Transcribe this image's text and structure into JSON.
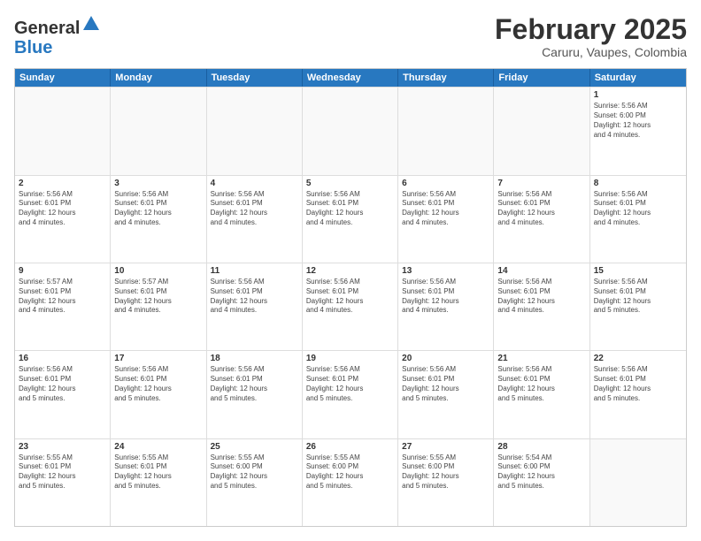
{
  "header": {
    "logo_general": "General",
    "logo_blue": "Blue",
    "month_title": "February 2025",
    "location": "Caruru, Vaupes, Colombia"
  },
  "weekdays": [
    "Sunday",
    "Monday",
    "Tuesday",
    "Wednesday",
    "Thursday",
    "Friday",
    "Saturday"
  ],
  "rows": [
    [
      {
        "day": "",
        "empty": true
      },
      {
        "day": "",
        "empty": true
      },
      {
        "day": "",
        "empty": true
      },
      {
        "day": "",
        "empty": true
      },
      {
        "day": "",
        "empty": true
      },
      {
        "day": "",
        "empty": true
      },
      {
        "day": "1",
        "info": "Sunrise: 5:56 AM\nSunset: 6:00 PM\nDaylight: 12 hours\nand 4 minutes."
      }
    ],
    [
      {
        "day": "2",
        "info": "Sunrise: 5:56 AM\nSunset: 6:01 PM\nDaylight: 12 hours\nand 4 minutes."
      },
      {
        "day": "3",
        "info": "Sunrise: 5:56 AM\nSunset: 6:01 PM\nDaylight: 12 hours\nand 4 minutes."
      },
      {
        "day": "4",
        "info": "Sunrise: 5:56 AM\nSunset: 6:01 PM\nDaylight: 12 hours\nand 4 minutes."
      },
      {
        "day": "5",
        "info": "Sunrise: 5:56 AM\nSunset: 6:01 PM\nDaylight: 12 hours\nand 4 minutes."
      },
      {
        "day": "6",
        "info": "Sunrise: 5:56 AM\nSunset: 6:01 PM\nDaylight: 12 hours\nand 4 minutes."
      },
      {
        "day": "7",
        "info": "Sunrise: 5:56 AM\nSunset: 6:01 PM\nDaylight: 12 hours\nand 4 minutes."
      },
      {
        "day": "8",
        "info": "Sunrise: 5:56 AM\nSunset: 6:01 PM\nDaylight: 12 hours\nand 4 minutes."
      }
    ],
    [
      {
        "day": "9",
        "info": "Sunrise: 5:57 AM\nSunset: 6:01 PM\nDaylight: 12 hours\nand 4 minutes."
      },
      {
        "day": "10",
        "info": "Sunrise: 5:57 AM\nSunset: 6:01 PM\nDaylight: 12 hours\nand 4 minutes."
      },
      {
        "day": "11",
        "info": "Sunrise: 5:56 AM\nSunset: 6:01 PM\nDaylight: 12 hours\nand 4 minutes."
      },
      {
        "day": "12",
        "info": "Sunrise: 5:56 AM\nSunset: 6:01 PM\nDaylight: 12 hours\nand 4 minutes."
      },
      {
        "day": "13",
        "info": "Sunrise: 5:56 AM\nSunset: 6:01 PM\nDaylight: 12 hours\nand 4 minutes."
      },
      {
        "day": "14",
        "info": "Sunrise: 5:56 AM\nSunset: 6:01 PM\nDaylight: 12 hours\nand 4 minutes."
      },
      {
        "day": "15",
        "info": "Sunrise: 5:56 AM\nSunset: 6:01 PM\nDaylight: 12 hours\nand 5 minutes."
      }
    ],
    [
      {
        "day": "16",
        "info": "Sunrise: 5:56 AM\nSunset: 6:01 PM\nDaylight: 12 hours\nand 5 minutes."
      },
      {
        "day": "17",
        "info": "Sunrise: 5:56 AM\nSunset: 6:01 PM\nDaylight: 12 hours\nand 5 minutes."
      },
      {
        "day": "18",
        "info": "Sunrise: 5:56 AM\nSunset: 6:01 PM\nDaylight: 12 hours\nand 5 minutes."
      },
      {
        "day": "19",
        "info": "Sunrise: 5:56 AM\nSunset: 6:01 PM\nDaylight: 12 hours\nand 5 minutes."
      },
      {
        "day": "20",
        "info": "Sunrise: 5:56 AM\nSunset: 6:01 PM\nDaylight: 12 hours\nand 5 minutes."
      },
      {
        "day": "21",
        "info": "Sunrise: 5:56 AM\nSunset: 6:01 PM\nDaylight: 12 hours\nand 5 minutes."
      },
      {
        "day": "22",
        "info": "Sunrise: 5:56 AM\nSunset: 6:01 PM\nDaylight: 12 hours\nand 5 minutes."
      }
    ],
    [
      {
        "day": "23",
        "info": "Sunrise: 5:55 AM\nSunset: 6:01 PM\nDaylight: 12 hours\nand 5 minutes."
      },
      {
        "day": "24",
        "info": "Sunrise: 5:55 AM\nSunset: 6:01 PM\nDaylight: 12 hours\nand 5 minutes."
      },
      {
        "day": "25",
        "info": "Sunrise: 5:55 AM\nSunset: 6:00 PM\nDaylight: 12 hours\nand 5 minutes."
      },
      {
        "day": "26",
        "info": "Sunrise: 5:55 AM\nSunset: 6:00 PM\nDaylight: 12 hours\nand 5 minutes."
      },
      {
        "day": "27",
        "info": "Sunrise: 5:55 AM\nSunset: 6:00 PM\nDaylight: 12 hours\nand 5 minutes."
      },
      {
        "day": "28",
        "info": "Sunrise: 5:54 AM\nSunset: 6:00 PM\nDaylight: 12 hours\nand 5 minutes."
      },
      {
        "day": "",
        "empty": true
      }
    ]
  ]
}
